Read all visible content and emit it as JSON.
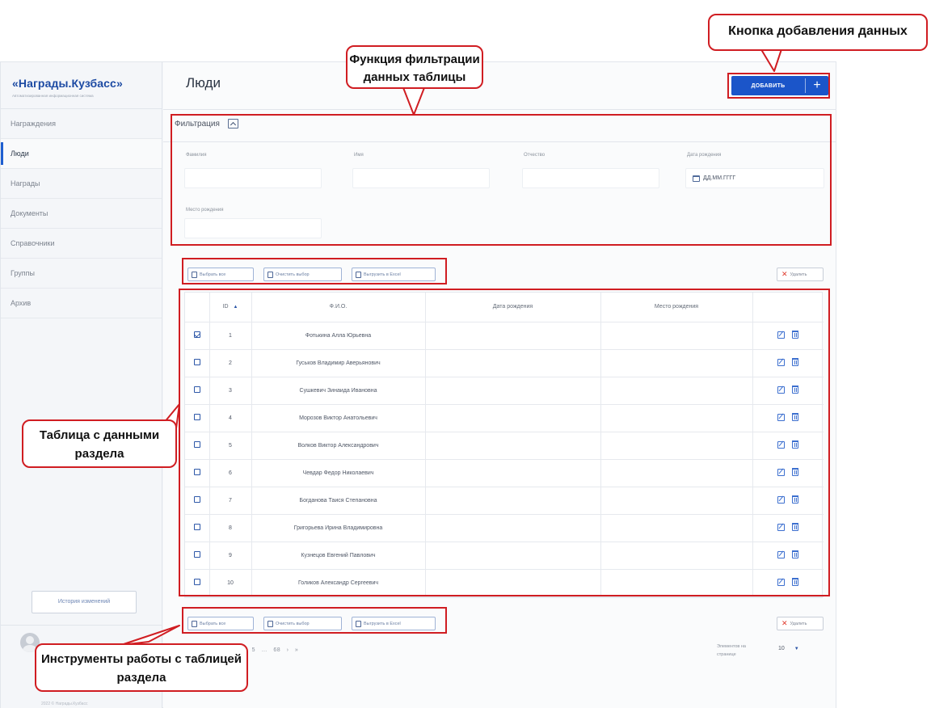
{
  "sidebar": {
    "logo_title": "«Награды.Кузбасс»",
    "logo_subtitle": "Автоматизированная информационная система",
    "items": [
      {
        "label": "Награждения"
      },
      {
        "label": "Люди"
      },
      {
        "label": "Награды"
      },
      {
        "label": "Документы"
      },
      {
        "label": "Справочники"
      },
      {
        "label": "Группы"
      },
      {
        "label": "Архив"
      }
    ],
    "active_item": "Люди",
    "history_button": "История изменений",
    "copyright": "2022 © Награды.Кузбасс"
  },
  "header": {
    "title": "Люди",
    "add_button": "ДОБАВИТЬ",
    "add_plus": "+"
  },
  "filter": {
    "title": "Фильтрация",
    "fields": {
      "lastname_label": "Фамилия",
      "firstname_label": "Имя",
      "patronymic_label": "Отчество",
      "birthdate_label": "Дата рождения",
      "birthdate_placeholder": "ДД.ММ.ГГГГ",
      "birthplace_label": "Место рождения"
    }
  },
  "toolbar": {
    "select_all": "Выбрать все",
    "clear_selection": "Очистить выбор",
    "export_excel": "Выгрузить в Excel",
    "delete": "Удалить"
  },
  "table": {
    "columns": [
      "ID",
      "Ф.И.О.",
      "Дата рождения",
      "Место рождения"
    ],
    "sort_indicator": "▲",
    "rows": [
      {
        "id": "1",
        "name": "Фотькина Алла Юрьевна",
        "checked": true
      },
      {
        "id": "2",
        "name": "Гуськов Владимир Аверьянович",
        "checked": false
      },
      {
        "id": "3",
        "name": "Сушкевич Зинаида Ивановна",
        "checked": false
      },
      {
        "id": "4",
        "name": "Морозов Виктор Анатольевич",
        "checked": false
      },
      {
        "id": "5",
        "name": "Волков Виктор Александрович",
        "checked": false
      },
      {
        "id": "6",
        "name": "Чевдар Федор Николаевич",
        "checked": false
      },
      {
        "id": "7",
        "name": "Богданова Таися Степановна",
        "checked": false
      },
      {
        "id": "8",
        "name": "Григорьева Ирина Владимировна",
        "checked": false
      },
      {
        "id": "9",
        "name": "Кузнецов Евгений Павлович",
        "checked": false
      },
      {
        "id": "10",
        "name": "Голиков Александр Сергеевич",
        "checked": false
      }
    ]
  },
  "pagination": {
    "text": "‹ 1 2 3 4 5 … 68 › »",
    "per_page_label": "Элементов на странице",
    "per_page_value": "10"
  },
  "annotations": {
    "filter_callout": "Функция фильтрации данных таблицы",
    "add_callout": "Кнопка добавления данных",
    "table_callout": "Таблица с данными раздела",
    "tools_callout": "Инструменты работы с таблицей раздела",
    "highlight_color": "#d01d22"
  },
  "colors": {
    "brand": "#1b55c9",
    "logo": "#1c4aa3",
    "delete_icon": "#e03b2e"
  }
}
